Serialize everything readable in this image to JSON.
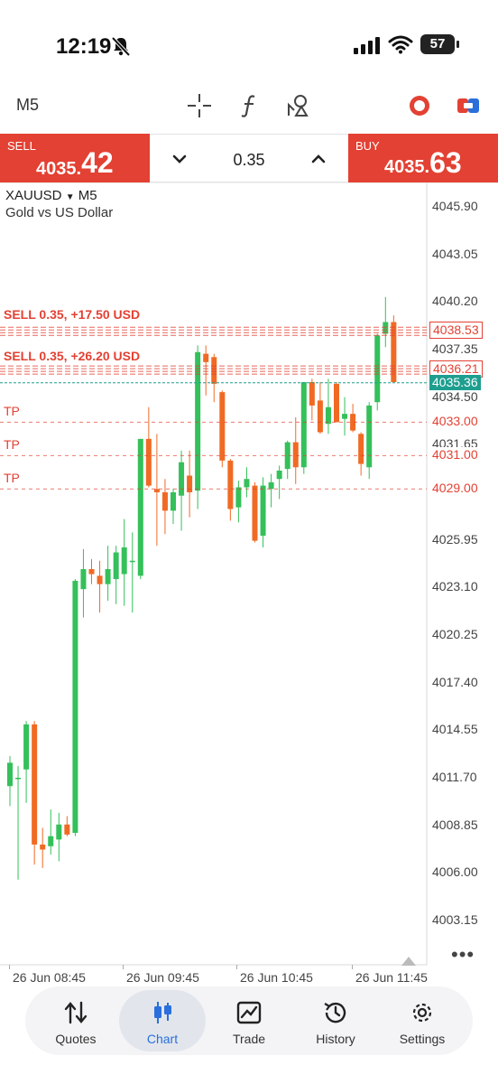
{
  "status": {
    "time": "12:19",
    "battery": "57"
  },
  "toolbar": {
    "timeframe": "M5"
  },
  "trade": {
    "sell_label": "SELL",
    "sell_price_small": "4035.",
    "sell_price_big": "42",
    "buy_label": "BUY",
    "buy_price_small": "4035.",
    "buy_price_big": "63",
    "volume": "0.35"
  },
  "chart": {
    "symbol": "XAUUSD",
    "timeframe": "M5",
    "description": "Gold vs US Dollar",
    "price_labels": [
      "4045.90",
      "4043.05",
      "4040.20",
      "4037.35",
      "4034.50",
      "4031.65",
      "4025.95",
      "4023.10",
      "4020.25",
      "4017.40",
      "4014.55",
      "4011.70",
      "4008.85",
      "4006.00",
      "4003.15"
    ],
    "time_labels": [
      "26 Jun 08:45",
      "26 Jun 09:45",
      "26 Jun 10:45",
      "26 Jun 11:45"
    ],
    "order_lines": [
      {
        "text": "SELL 0.35, +17.50 USD",
        "price": "4038.53"
      },
      {
        "text": "SELL 0.35, +26.20 USD",
        "price": "4036.21"
      }
    ],
    "bid_price": "4035.36",
    "tp_lines": [
      {
        "text": "TP",
        "price": "4033.00"
      },
      {
        "text": "TP",
        "price": "4031.00"
      },
      {
        "text": "TP",
        "price": "4029.00"
      }
    ],
    "colors": {
      "bull": "#34c05a",
      "bear": "#f06a24",
      "sell_line": "#e34133",
      "bid": "#1e9e8f",
      "order_text": "#3a7bd5"
    }
  },
  "chart_data": {
    "type": "candlestick",
    "ylim": [
      4001.5,
      4047.2
    ],
    "x_ticks": [
      "26 Jun 08:45",
      "26 Jun 09:45",
      "26 Jun 10:45",
      "26 Jun 11:45"
    ],
    "candles": [
      {
        "o": 4011.2,
        "h": 4013.0,
        "l": 4010.0,
        "c": 4012.6
      },
      {
        "o": 4011.7,
        "h": 4012.4,
        "l": 4005.6,
        "c": 4011.7
      },
      {
        "o": 4012.2,
        "h": 4015.1,
        "l": 4010.2,
        "c": 4014.9
      },
      {
        "o": 4014.9,
        "h": 4015.1,
        "l": 4006.5,
        "c": 4007.7
      },
      {
        "o": 4007.7,
        "h": 4008.7,
        "l": 4006.3,
        "c": 4007.4
      },
      {
        "o": 4007.6,
        "h": 4009.8,
        "l": 4007.1,
        "c": 4008.2
      },
      {
        "o": 4008.0,
        "h": 4009.6,
        "l": 4006.7,
        "c": 4008.9
      },
      {
        "o": 4008.9,
        "h": 4009.4,
        "l": 4008.2,
        "c": 4008.3
      },
      {
        "o": 4008.4,
        "h": 4023.6,
        "l": 4008.2,
        "c": 4023.5
      },
      {
        "o": 4023.0,
        "h": 4025.4,
        "l": 4021.3,
        "c": 4024.2
      },
      {
        "o": 4024.2,
        "h": 4024.8,
        "l": 4023.3,
        "c": 4023.9
      },
      {
        "o": 4023.8,
        "h": 4024.7,
        "l": 4021.6,
        "c": 4023.3
      },
      {
        "o": 4023.3,
        "h": 4025.6,
        "l": 4022.3,
        "c": 4024.2
      },
      {
        "o": 4023.6,
        "h": 4025.6,
        "l": 4022.1,
        "c": 4025.2
      },
      {
        "o": 4023.9,
        "h": 4027.2,
        "l": 4022.0,
        "c": 4025.5
      },
      {
        "o": 4024.7,
        "h": 4026.4,
        "l": 4021.6,
        "c": 4024.7
      },
      {
        "o": 4023.8,
        "h": 4032.0,
        "l": 4023.6,
        "c": 4032.0
      },
      {
        "o": 4032.0,
        "h": 4033.9,
        "l": 4029.1,
        "c": 4029.2
      },
      {
        "o": 4029.0,
        "h": 4032.3,
        "l": 4025.6,
        "c": 4028.8
      },
      {
        "o": 4028.8,
        "h": 4029.6,
        "l": 4026.3,
        "c": 4027.7
      },
      {
        "o": 4027.7,
        "h": 4029.0,
        "l": 4026.9,
        "c": 4028.8
      },
      {
        "o": 4028.6,
        "h": 4031.3,
        "l": 4026.5,
        "c": 4030.6
      },
      {
        "o": 4029.8,
        "h": 4031.3,
        "l": 4027.3,
        "c": 4028.8
      },
      {
        "o": 4028.9,
        "h": 4037.6,
        "l": 4027.8,
        "c": 4037.2
      },
      {
        "o": 4037.1,
        "h": 4037.6,
        "l": 4034.6,
        "c": 4036.6
      },
      {
        "o": 4036.9,
        "h": 4037.1,
        "l": 4034.2,
        "c": 4035.3
      },
      {
        "o": 4034.8,
        "h": 4034.9,
        "l": 4030.3,
        "c": 4030.7
      },
      {
        "o": 4030.7,
        "h": 4030.8,
        "l": 4027.1,
        "c": 4027.8
      },
      {
        "o": 4027.9,
        "h": 4029.5,
        "l": 4027.0,
        "c": 4029.1
      },
      {
        "o": 4029.1,
        "h": 4030.3,
        "l": 4028.5,
        "c": 4029.6
      },
      {
        "o": 4029.2,
        "h": 4029.4,
        "l": 4025.8,
        "c": 4025.9
      },
      {
        "o": 4026.2,
        "h": 4029.7,
        "l": 4025.5,
        "c": 4029.2
      },
      {
        "o": 4029.0,
        "h": 4029.9,
        "l": 4027.9,
        "c": 4029.4
      },
      {
        "o": 4029.6,
        "h": 4030.4,
        "l": 4028.4,
        "c": 4030.1
      },
      {
        "o": 4030.2,
        "h": 4031.9,
        "l": 4029.6,
        "c": 4031.8
      },
      {
        "o": 4031.8,
        "h": 4033.3,
        "l": 4029.3,
        "c": 4030.3
      },
      {
        "o": 4030.3,
        "h": 4035.4,
        "l": 4029.9,
        "c": 4035.4
      },
      {
        "o": 4035.4,
        "h": 4035.6,
        "l": 4033.1,
        "c": 4034.0
      },
      {
        "o": 4034.3,
        "h": 4035.4,
        "l": 4032.3,
        "c": 4032.4
      },
      {
        "o": 4032.9,
        "h": 4035.6,
        "l": 4032.3,
        "c": 4033.9
      },
      {
        "o": 4035.3,
        "h": 4035.4,
        "l": 4033.0,
        "c": 4033.0
      },
      {
        "o": 4033.2,
        "h": 4034.5,
        "l": 4032.2,
        "c": 4033.5
      },
      {
        "o": 4033.5,
        "h": 4034.1,
        "l": 4032.4,
        "c": 4032.5
      },
      {
        "o": 4032.3,
        "h": 4032.4,
        "l": 4029.8,
        "c": 4030.5
      },
      {
        "o": 4030.3,
        "h": 4034.2,
        "l": 4029.6,
        "c": 4034.0
      },
      {
        "o": 4034.2,
        "h": 4038.3,
        "l": 4033.7,
        "c": 4038.2
      },
      {
        "o": 4038.3,
        "h": 4040.5,
        "l": 4037.5,
        "c": 4039.0
      },
      {
        "o": 4039.0,
        "h": 4039.4,
        "l": 4035.4,
        "c": 4035.4
      }
    ]
  },
  "nav": {
    "items": [
      "Quotes",
      "Chart",
      "Trade",
      "History",
      "Settings"
    ],
    "active": "Chart"
  }
}
